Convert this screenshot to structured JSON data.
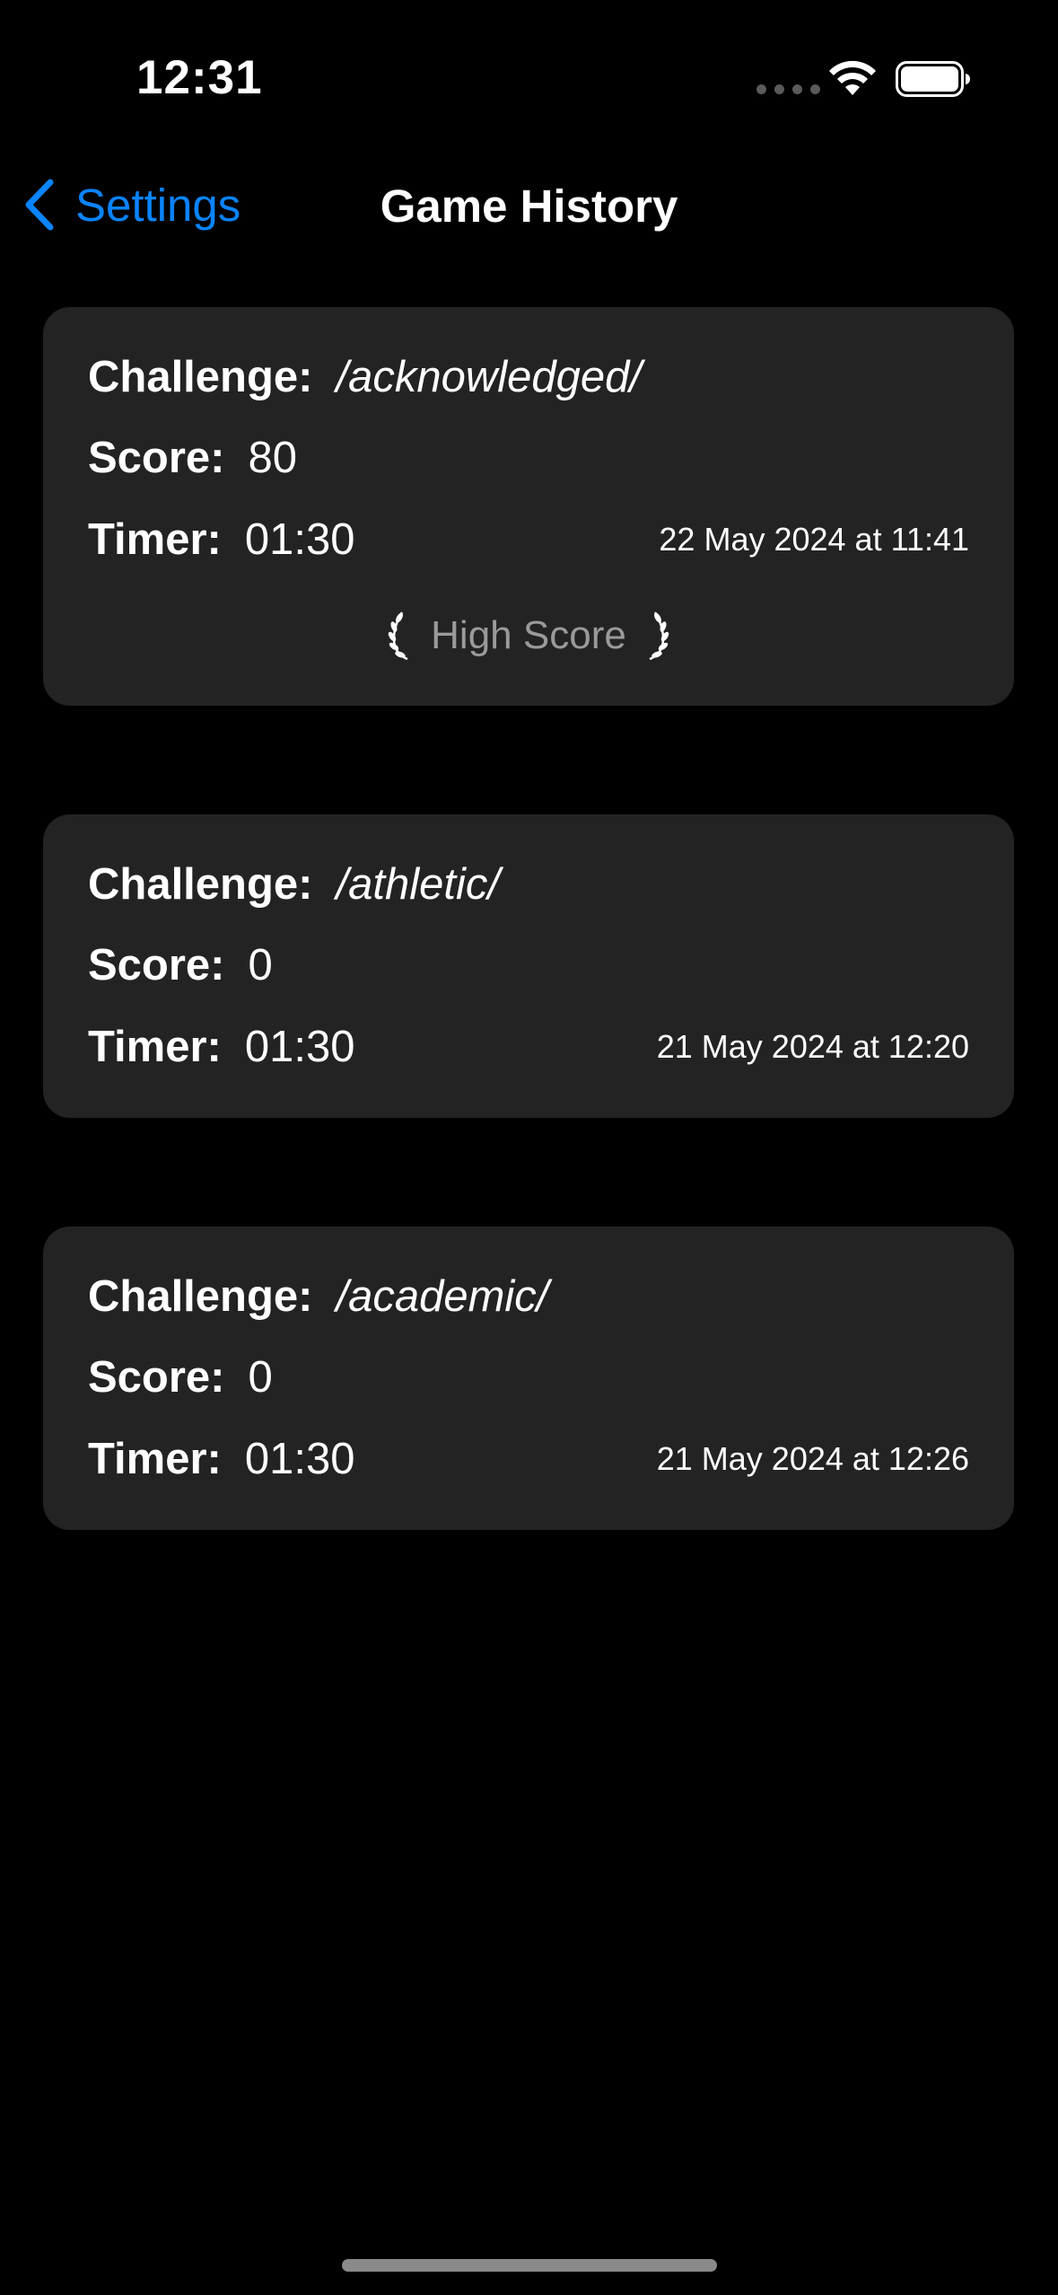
{
  "status_bar": {
    "time": "12:31",
    "icons": [
      "cellular-signal-icon",
      "wifi-icon",
      "battery-icon"
    ]
  },
  "nav": {
    "back_label": "Settings",
    "title": "Game History"
  },
  "labels": {
    "challenge": "Challenge:",
    "score": "Score:",
    "timer": "Timer:",
    "high_score": "High Score"
  },
  "games": [
    {
      "challenge": "/acknowledged/",
      "score": "80",
      "timer": "01:30",
      "date": "22 May 2024 at 11:41",
      "high_score": true
    },
    {
      "challenge": "/athletic/",
      "score": "0",
      "timer": "01:30",
      "date": "21 May 2024 at 12:20",
      "high_score": false
    },
    {
      "challenge": "/academic/",
      "score": "0",
      "timer": "01:30",
      "date": "21 May 2024 at 12:26",
      "high_score": false
    }
  ],
  "colors": {
    "background": "#000000",
    "card": "#232323",
    "accent": "#0a84ff",
    "high_score_text": "#9a9a9a"
  }
}
